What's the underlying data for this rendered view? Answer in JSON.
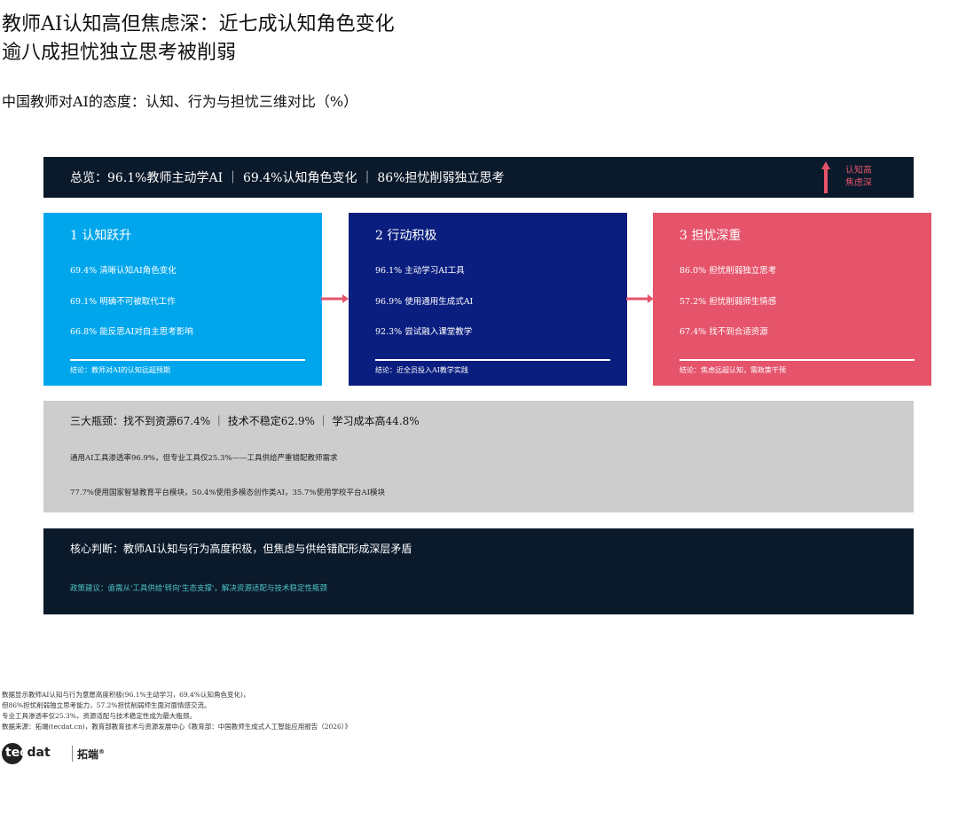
{
  "title": {
    "line1": "教师AI认知高但焦虑深：近七成认知角色变化",
    "line2": "逾八成担忧独立思考被削弱"
  },
  "subtitle": "中国教师对AI的态度：认知、行为与担忧三维对比（%）",
  "overview": {
    "text": "总览：96.1%教师主动学AI ｜ 69.4%认知角色变化 ｜ 86%担忧削弱独立思考",
    "note1": "认知高",
    "note2": "焦虑深",
    "arrow_icon": "up-arrow-icon",
    "arrow_color": "#e5546b"
  },
  "cards": [
    {
      "title": "1 认知跃升",
      "items": [
        "69.4% 清晰认知AI角色变化",
        "69.1% 明确不可被取代工作",
        "66.8% 能反思AI对自主思考影响"
      ],
      "conclusion": "结论：教师对AI的认知远超预期",
      "color": "#00a6ec"
    },
    {
      "title": "2 行动积极",
      "items": [
        "96.1% 主动学习AI工具",
        "96.9% 使用通用生成式AI",
        "92.3% 尝试融入课堂教学"
      ],
      "conclusion": "结论：近全员投入AI教学实践",
      "color": "#0a1e7f"
    },
    {
      "title": "3 担忧深重",
      "items": [
        "86.0% 担忧削弱独立思考",
        "57.2% 担忧削弱师生情感",
        "67.4% 找不到合适资源"
      ],
      "conclusion": "结论：焦虑远超认知，需政策干预",
      "color": "#e5546b"
    }
  ],
  "bottleneck": {
    "title": "三大瓶颈：找不到资源67.4% ｜ 技术不稳定62.9% ｜ 学习成本高44.8%",
    "line1": "通用AI工具渗透率96.9%，但专业工具仅25.3%——工具供给严重错配教师需求",
    "line2": "77.7%使用国家智慧教育平台模块，50.4%使用多模态创作类AI，35.7%使用学校平台AI模块"
  },
  "core": {
    "title": "核心判断：教师AI认知与行为高度积极，但焦虑与供给错配形成深层矛盾",
    "suggestion": "政策建议：亟需从'工具供给'转向'生态支撑'，解决资源适配与技术稳定性瓶颈"
  },
  "footnote": [
    "数据显示教师AI认知与行为意愿高度积极(96.1%主动学习，69.4%认知角色变化)，",
    "但86%担忧削弱独立思考能力，57.2%担忧削弱师生面对面情感交流。",
    "专业工具渗透率仅25.3%，资源适配与技术稳定性成为最大瓶颈。",
    "数据来源：拓端(tecdat.cn)，教育部教育技术与资源发展中心《教育部：中国教师生成式人工智能应用报告（2026）》"
  ],
  "logo": {
    "tec": "tec",
    "dat": "dat",
    "cn": "拓端",
    "reg": "®"
  },
  "colors": {
    "dark": "#0b1a2b",
    "gray": "#cdcdcd",
    "teal": "#4fc3c8",
    "connector": "#e5546b"
  }
}
